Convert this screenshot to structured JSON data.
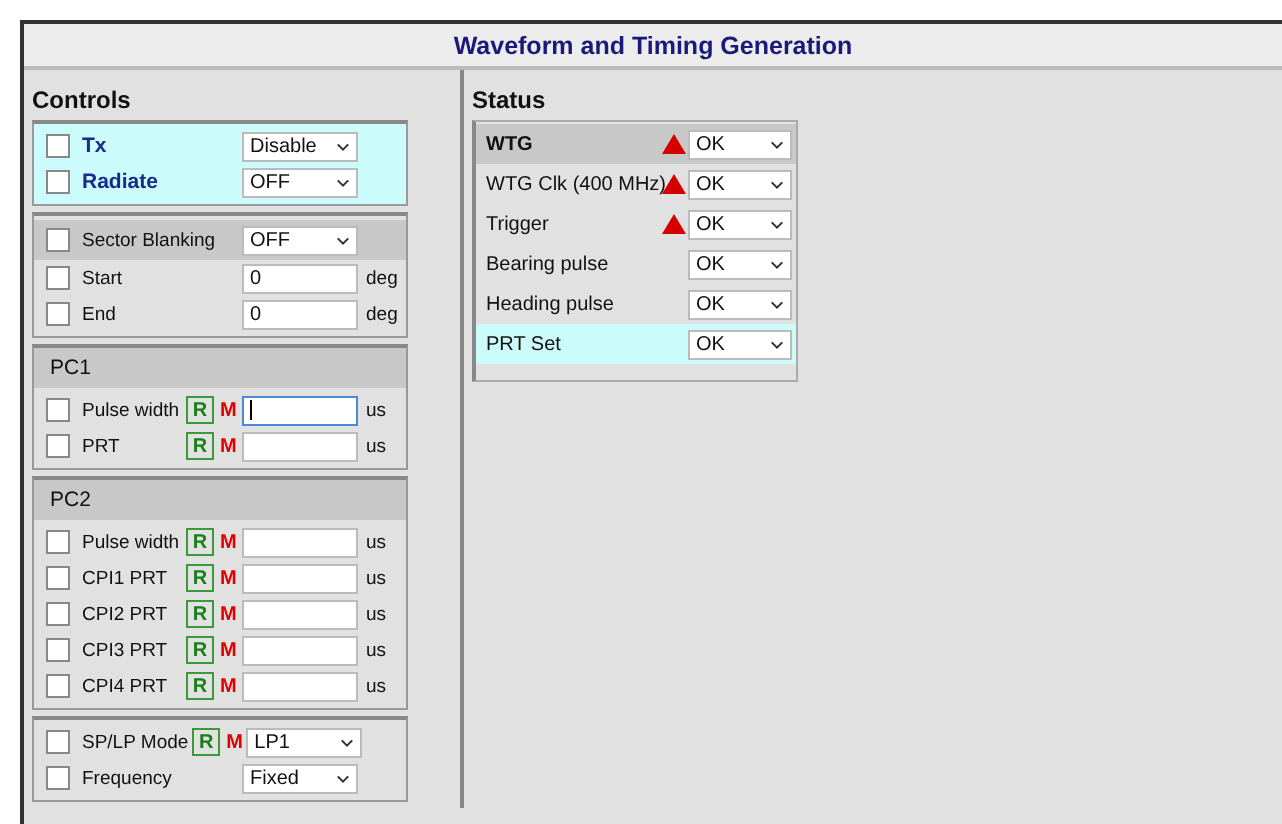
{
  "window": {
    "title": "Waveform and Timing Generation"
  },
  "controls": {
    "title": "Controls",
    "groups": [
      {
        "highlighted": true,
        "rows": [
          {
            "kind": "select",
            "label": "Tx",
            "emphasis": true,
            "banded": false,
            "checked": false,
            "value": "Disable",
            "focused": false
          },
          {
            "kind": "select",
            "label": "Radiate",
            "emphasis": true,
            "banded": false,
            "checked": false,
            "value": "OFF",
            "focused": false
          }
        ]
      },
      {
        "highlighted": false,
        "rows": [
          {
            "kind": "select",
            "label": "Sector Blanking",
            "emphasis": false,
            "banded": true,
            "checked": false,
            "value": "OFF",
            "focused": false
          },
          {
            "kind": "input",
            "label": "Start",
            "emphasis": false,
            "banded": false,
            "checked": false,
            "value": "0",
            "unit": "deg",
            "focused": false
          },
          {
            "kind": "input",
            "label": "End",
            "emphasis": false,
            "banded": false,
            "checked": false,
            "value": "0",
            "unit": "deg",
            "focused": false
          }
        ]
      },
      {
        "highlighted": false,
        "title": "PC1",
        "rows": [
          {
            "kind": "rm_input",
            "label": "Pulse width",
            "emphasis": false,
            "banded": false,
            "checked": false,
            "r": "R",
            "m": "M",
            "unit": "us",
            "focused": true
          },
          {
            "kind": "rm_input",
            "label": "PRT",
            "emphasis": false,
            "banded": false,
            "checked": false,
            "r": "R",
            "m": "M",
            "unit": "us",
            "focused": false
          }
        ]
      },
      {
        "highlighted": false,
        "title": "PC2",
        "rows": [
          {
            "kind": "rm_input",
            "label": "Pulse width",
            "emphasis": false,
            "banded": false,
            "checked": false,
            "r": "R",
            "m": "M",
            "unit": "us",
            "focused": false
          },
          {
            "kind": "rm_input",
            "label": "CPI1 PRT",
            "emphasis": false,
            "banded": false,
            "checked": false,
            "r": "R",
            "m": "M",
            "unit": "us",
            "focused": false
          },
          {
            "kind": "rm_input",
            "label": "CPI2 PRT",
            "emphasis": false,
            "banded": false,
            "checked": false,
            "r": "R",
            "m": "M",
            "unit": "us",
            "focused": false
          },
          {
            "kind": "rm_input",
            "label": "CPI3 PRT",
            "emphasis": false,
            "banded": false,
            "checked": false,
            "r": "R",
            "m": "M",
            "unit": "us",
            "focused": false
          },
          {
            "kind": "rm_input",
            "label": "CPI4 PRT",
            "emphasis": false,
            "banded": false,
            "checked": false,
            "r": "R",
            "m": "M",
            "unit": "us",
            "focused": false
          }
        ]
      },
      {
        "highlighted": false,
        "rows": [
          {
            "kind": "rm_select",
            "label": "SP/LP Mode",
            "emphasis": false,
            "banded": false,
            "checked": false,
            "r": "R",
            "m": "M",
            "value": "LP1",
            "focused": false
          },
          {
            "kind": "select",
            "label": "Frequency",
            "emphasis": false,
            "banded": false,
            "checked": false,
            "value": "Fixed",
            "focused": false
          }
        ]
      }
    ]
  },
  "status": {
    "title": "Status",
    "rows": [
      {
        "label": "WTG",
        "emphasis": true,
        "banded": true,
        "highlighted": false,
        "alarm": true,
        "value": "OK"
      },
      {
        "label": "WTG Clk (400 MHz)",
        "emphasis": false,
        "banded": false,
        "highlighted": false,
        "alarm": true,
        "value": "OK"
      },
      {
        "label": "Trigger",
        "emphasis": false,
        "banded": false,
        "highlighted": false,
        "alarm": true,
        "value": "OK"
      },
      {
        "label": "Bearing pulse",
        "emphasis": false,
        "banded": false,
        "highlighted": false,
        "alarm": false,
        "value": "OK"
      },
      {
        "label": "Heading pulse",
        "emphasis": false,
        "banded": false,
        "highlighted": false,
        "alarm": false,
        "value": "OK"
      },
      {
        "label": "PRT Set",
        "emphasis": false,
        "banded": false,
        "highlighted": true,
        "alarm": false,
        "value": "OK"
      }
    ]
  }
}
